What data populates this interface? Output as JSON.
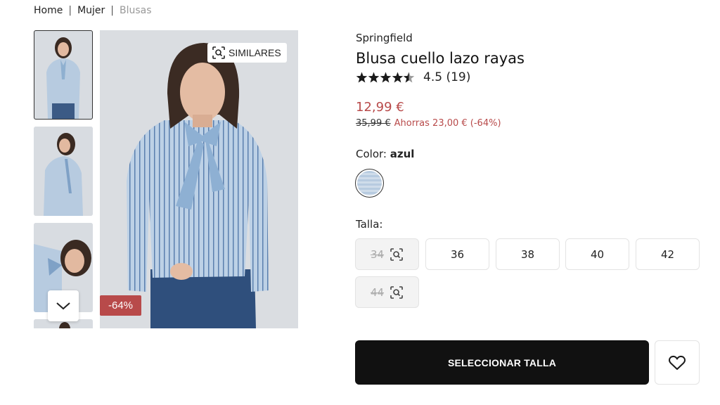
{
  "breadcrumb": [
    {
      "label": "Home"
    },
    {
      "label": "Mujer"
    },
    {
      "label": "Blusas"
    }
  ],
  "breadcrumb_separator": "|",
  "gallery": {
    "similares_label": "SIMILARES",
    "discount_badge": "-64%",
    "thumbnail_count_visible": 4
  },
  "product": {
    "brand": "Springfield",
    "title": "Blusa cuello lazo rayas",
    "rating_text": "4.5 (19)",
    "rating_value": 4.5,
    "rating_max": 5,
    "price": "12,99 €",
    "old_price": "35,99 €",
    "savings": "Ahorras 23,00 € (-64%)",
    "color_label": "Color:",
    "color_value": "azul",
    "size_label": "Talla:",
    "sizes": [
      {
        "label": "34",
        "available": false
      },
      {
        "label": "36",
        "available": true
      },
      {
        "label": "38",
        "available": true
      },
      {
        "label": "40",
        "available": true
      },
      {
        "label": "42",
        "available": true
      },
      {
        "label": "44",
        "available": false
      }
    ],
    "cta_label": "SELECCIONAR TALLA"
  },
  "colors": {
    "accent_red": "#b84a4a",
    "cta_background": "#111111",
    "shirt_blue": "#b7cbe0"
  },
  "icons": {
    "similar": "visual-search-icon",
    "down": "chevron-down-icon",
    "favorite": "heart-icon",
    "star": "star-icon"
  }
}
